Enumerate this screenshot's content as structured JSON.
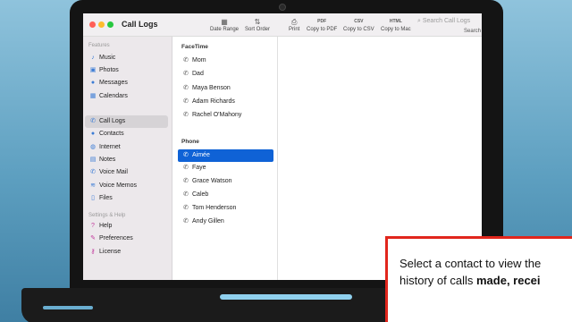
{
  "window": {
    "title": "Call Logs"
  },
  "toolbar": {
    "date_range": {
      "label": "Date Range",
      "icon": "calendar-icon"
    },
    "sort_order": {
      "label": "Sort Order",
      "icon": "sort-icon"
    },
    "print": {
      "label": "Print",
      "icon": "printer-icon"
    },
    "copy_pdf": {
      "label": "Copy to PDF",
      "icon_text": "PDF"
    },
    "copy_csv": {
      "label": "Copy to CSV",
      "icon_text": "CSV"
    },
    "copy_mac": {
      "label": "Copy to Mac",
      "icon_text": "HTML"
    },
    "search_placeholder": "Search Call Logs",
    "search_label": "Search"
  },
  "sidebar": {
    "features_title": "Features",
    "items": [
      {
        "label": "Music",
        "icon": "music-note-icon"
      },
      {
        "label": "Photos",
        "icon": "photos-icon"
      },
      {
        "label": "Messages",
        "icon": "message-bubble-icon"
      },
      {
        "label": "Calendars",
        "icon": "calendar-icon"
      },
      {
        "label": "Call Logs",
        "icon": "phone-icon"
      },
      {
        "label": "Contacts",
        "icon": "person-icon"
      },
      {
        "label": "Internet",
        "icon": "globe-icon"
      },
      {
        "label": "Notes",
        "icon": "note-icon"
      },
      {
        "label": "Voice Mail",
        "icon": "voicemail-icon"
      },
      {
        "label": "Voice Memos",
        "icon": "waveform-icon"
      },
      {
        "label": "Files",
        "icon": "file-icon"
      }
    ],
    "settings_title": "Settings & Help",
    "settings_items": [
      {
        "label": "Help",
        "icon": "help-icon"
      },
      {
        "label": "Preferences",
        "icon": "wrench-icon"
      },
      {
        "label": "License",
        "icon": "key-icon"
      }
    ]
  },
  "contacts": {
    "facetime_title": "FaceTime",
    "facetime": [
      "Mom",
      "Dad",
      "Maya Benson",
      "Adam Richards",
      "Rachel O'Mahony"
    ],
    "phone_title": "Phone",
    "phone": [
      "Aimée",
      "Faye",
      "Grace Watson",
      "Caleb",
      "Tom Henderson",
      "Andy Gillen"
    ],
    "selected": "Aimée"
  },
  "caption": {
    "text_plain": "Select a contact to view the history of calls ",
    "text_bold": "made, recei"
  },
  "colors": {
    "accent": "#0f62d6",
    "caption_border": "#e1261c"
  }
}
